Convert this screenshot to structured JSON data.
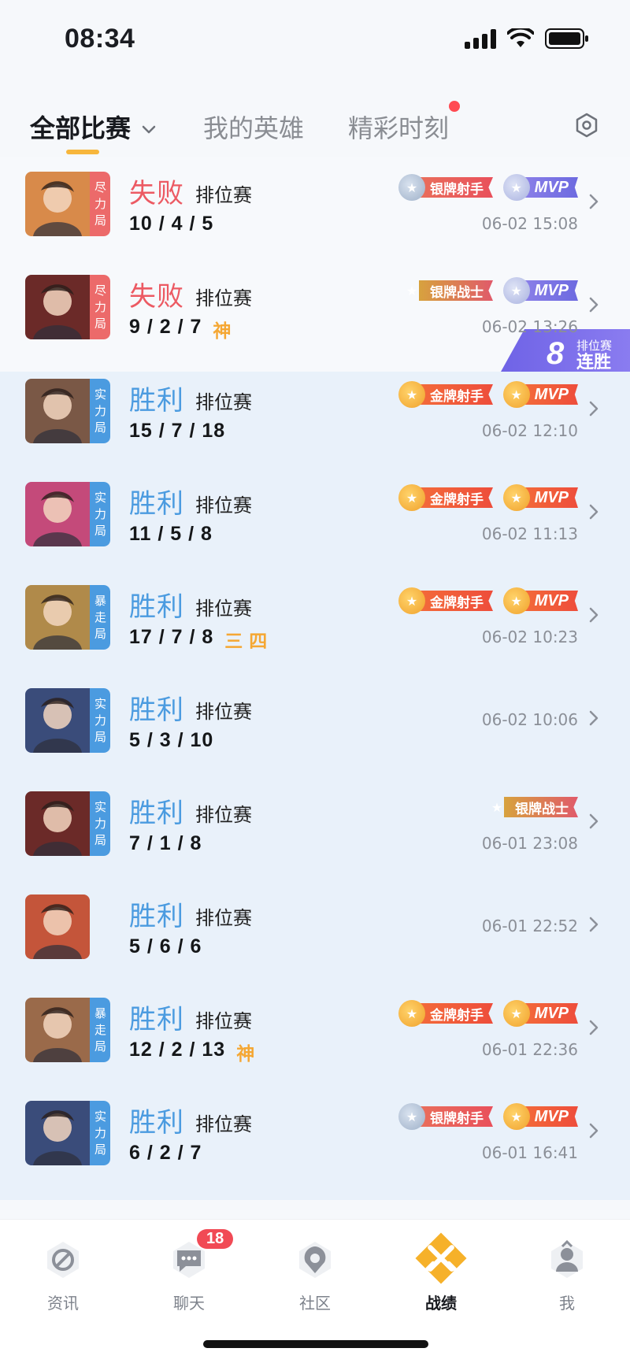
{
  "status_bar": {
    "time": "08:34"
  },
  "tabs": [
    {
      "label": "全部比赛",
      "active": true
    },
    {
      "label": "我的英雄",
      "active": false
    },
    {
      "label": "精彩时刻",
      "active": false,
      "has_dot": true
    }
  ],
  "streak": {
    "type": "排位赛",
    "count": "8",
    "label": "连胜"
  },
  "matches": [
    {
      "result": "失败",
      "outcome": "loss",
      "mode": "尽力局",
      "mode_color": "red",
      "game_type": "排位赛",
      "kda": "10 / 4 / 5",
      "extra": "",
      "badges": [
        {
          "type": "silver",
          "label": "银牌射手"
        },
        {
          "type": "mvp-silver",
          "label": "MVP"
        }
      ],
      "time": "06-02 15:08",
      "avatar_hue": "#d88a4a"
    },
    {
      "result": "失败",
      "outcome": "loss",
      "mode": "尽力局",
      "mode_color": "red",
      "game_type": "排位赛",
      "kda": "9 / 2 / 7",
      "extra": "神",
      "badges": [
        {
          "type": "silver-fighter",
          "label": "银牌战士"
        },
        {
          "type": "mvp-silver",
          "label": "MVP"
        }
      ],
      "time": "06-02 13:26",
      "avatar_hue": "#6b2a28"
    },
    {
      "result": "胜利",
      "outcome": "win",
      "mode": "实力局",
      "mode_color": "blue",
      "game_type": "排位赛",
      "kda": "15 / 7 / 18",
      "extra": "",
      "badges": [
        {
          "type": "gold",
          "label": "金牌射手"
        },
        {
          "type": "mvp-gold",
          "label": "MVP"
        }
      ],
      "time": "06-02 12:10",
      "avatar_hue": "#7a5846"
    },
    {
      "result": "胜利",
      "outcome": "win",
      "mode": "实力局",
      "mode_color": "blue",
      "game_type": "排位赛",
      "kda": "11 / 5 / 8",
      "extra": "",
      "badges": [
        {
          "type": "gold",
          "label": "金牌射手"
        },
        {
          "type": "mvp-gold",
          "label": "MVP"
        }
      ],
      "time": "06-02 11:13",
      "avatar_hue": "#c44a7a"
    },
    {
      "result": "胜利",
      "outcome": "win",
      "mode": "暴走局",
      "mode_color": "blue",
      "game_type": "排位赛",
      "kda": "17 / 7 / 8",
      "extra": "三  四",
      "badges": [
        {
          "type": "gold",
          "label": "金牌射手"
        },
        {
          "type": "mvp-gold",
          "label": "MVP"
        }
      ],
      "time": "06-02 10:23",
      "avatar_hue": "#b08a4a"
    },
    {
      "result": "胜利",
      "outcome": "win",
      "mode": "实力局",
      "mode_color": "blue",
      "game_type": "排位赛",
      "kda": "5 / 3 / 10",
      "extra": "",
      "badges": [],
      "time": "06-02 10:06",
      "avatar_hue": "#3a4c7a"
    },
    {
      "result": "胜利",
      "outcome": "win",
      "mode": "实力局",
      "mode_color": "blue",
      "game_type": "排位赛",
      "kda": "7 / 1 / 8",
      "extra": "",
      "badges": [
        {
          "type": "silver-fighter",
          "label": "银牌战士"
        }
      ],
      "time": "06-01 23:08",
      "avatar_hue": "#6b2a28"
    },
    {
      "result": "胜利",
      "outcome": "win",
      "mode": "",
      "mode_color": "none",
      "game_type": "排位赛",
      "kda": "5 / 6 / 6",
      "extra": "",
      "badges": [],
      "time": "06-01 22:52",
      "avatar_hue": "#c4553a"
    },
    {
      "result": "胜利",
      "outcome": "win",
      "mode": "暴走局",
      "mode_color": "blue",
      "game_type": "排位赛",
      "kda": "12 / 2 / 13",
      "extra": "神",
      "badges": [
        {
          "type": "gold",
          "label": "金牌射手"
        },
        {
          "type": "mvp-gold",
          "label": "MVP"
        }
      ],
      "time": "06-01 22:36",
      "avatar_hue": "#9a6a4a"
    },
    {
      "result": "胜利",
      "outcome": "win",
      "mode": "实力局",
      "mode_color": "blue",
      "game_type": "排位赛",
      "kda": "6 / 2 / 7",
      "extra": "",
      "badges": [
        {
          "type": "silver",
          "label": "银牌射手"
        },
        {
          "type": "mvp-gold",
          "label": "MVP"
        }
      ],
      "time": "06-01 16:41",
      "avatar_hue": "#3a4c7a"
    }
  ],
  "bottom_nav": [
    {
      "label": "资讯",
      "icon": "news-icon",
      "active": false
    },
    {
      "label": "聊天",
      "icon": "chat-icon",
      "active": false,
      "badge": "18"
    },
    {
      "label": "社区",
      "icon": "community-icon",
      "active": false
    },
    {
      "label": "战绩",
      "icon": "battle-record-icon",
      "active": true
    },
    {
      "label": "我",
      "icon": "profile-icon",
      "active": false
    }
  ],
  "colors": {
    "loss": "#ec5a63",
    "win": "#4b9be0",
    "accent": "#f7b63c"
  }
}
